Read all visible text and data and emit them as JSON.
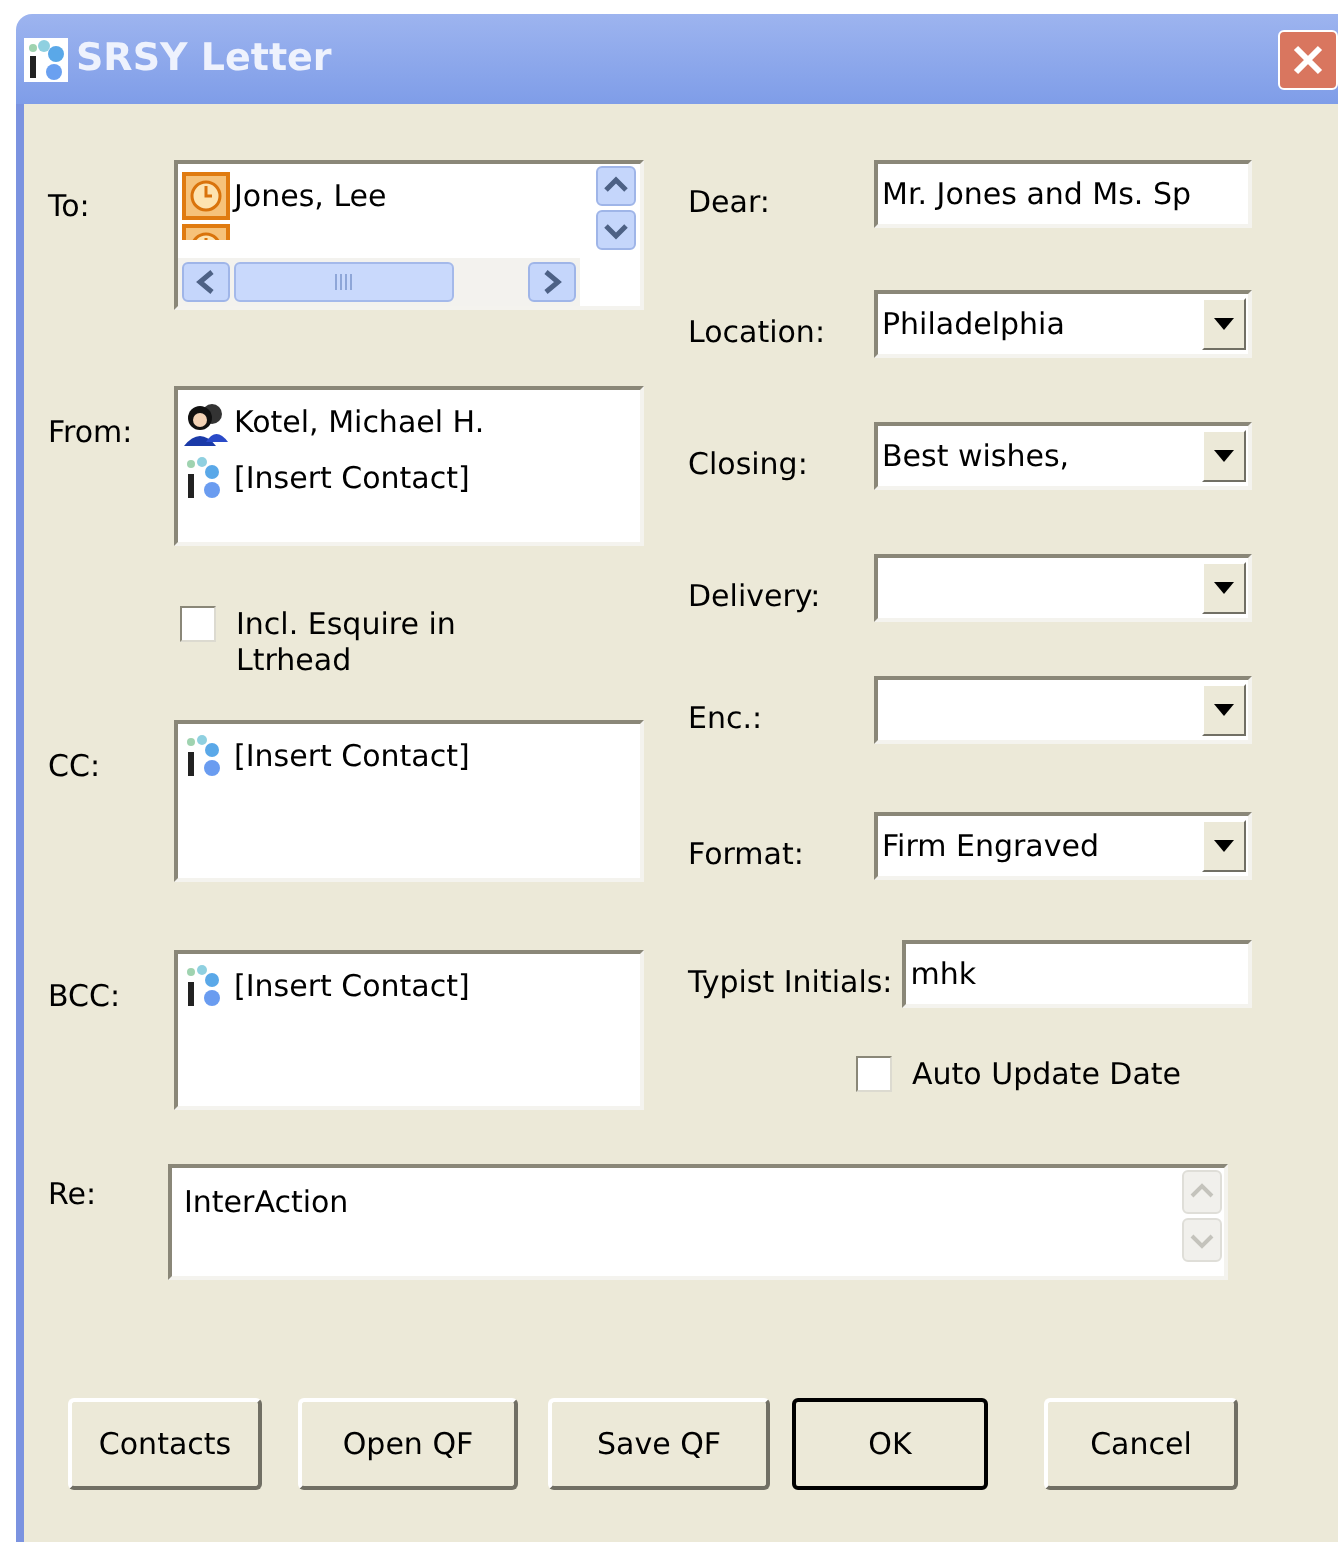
{
  "window": {
    "title": "SRSY Letter"
  },
  "to": {
    "label": "To:",
    "contacts": [
      {
        "kind": "clock",
        "name": "Jones, Lee"
      },
      {
        "kind": "clock"
      }
    ]
  },
  "from": {
    "label": "From:",
    "contacts": [
      {
        "kind": "person",
        "name": "Kotel, Michael H."
      },
      {
        "kind": "insert",
        "name": "[Insert Contact]"
      }
    ]
  },
  "esquire_checkbox": {
    "label": "Incl. Esquire in Ltrhead",
    "checked": false
  },
  "cc": {
    "label": "CC:",
    "contacts": [
      {
        "kind": "insert",
        "name": "[Insert Contact]"
      }
    ]
  },
  "bcc": {
    "label": "BCC:",
    "contacts": [
      {
        "kind": "insert",
        "name": "[Insert Contact]"
      }
    ]
  },
  "fields": [
    {
      "kind": "text",
      "label": "Dear:",
      "value": "Mr. Jones and Ms. Sp"
    },
    {
      "kind": "combo",
      "label": "Location:",
      "value": "Philadelphia"
    },
    {
      "kind": "combo",
      "label": "Closing:",
      "value": "Best wishes,"
    },
    {
      "kind": "combo",
      "label": "Delivery:"
    },
    {
      "kind": "combo",
      "label": "Enc.:"
    },
    {
      "kind": "combo",
      "label": "Format:",
      "value": "Firm Engraved"
    },
    {
      "kind": "text",
      "label": "Typist Initials:",
      "value": "mhk"
    }
  ],
  "auto_update_checkbox": {
    "label": "Auto Update Date",
    "checked": false
  },
  "re": {
    "label": "Re:",
    "value": "InterAction"
  },
  "buttons": [
    {
      "label": "Contacts",
      "default": false
    },
    {
      "label": "Open QF",
      "default": false
    },
    {
      "label": "Save QF",
      "default": false
    },
    {
      "label": "OK",
      "default": true
    },
    {
      "label": "Cancel",
      "default": false
    }
  ]
}
